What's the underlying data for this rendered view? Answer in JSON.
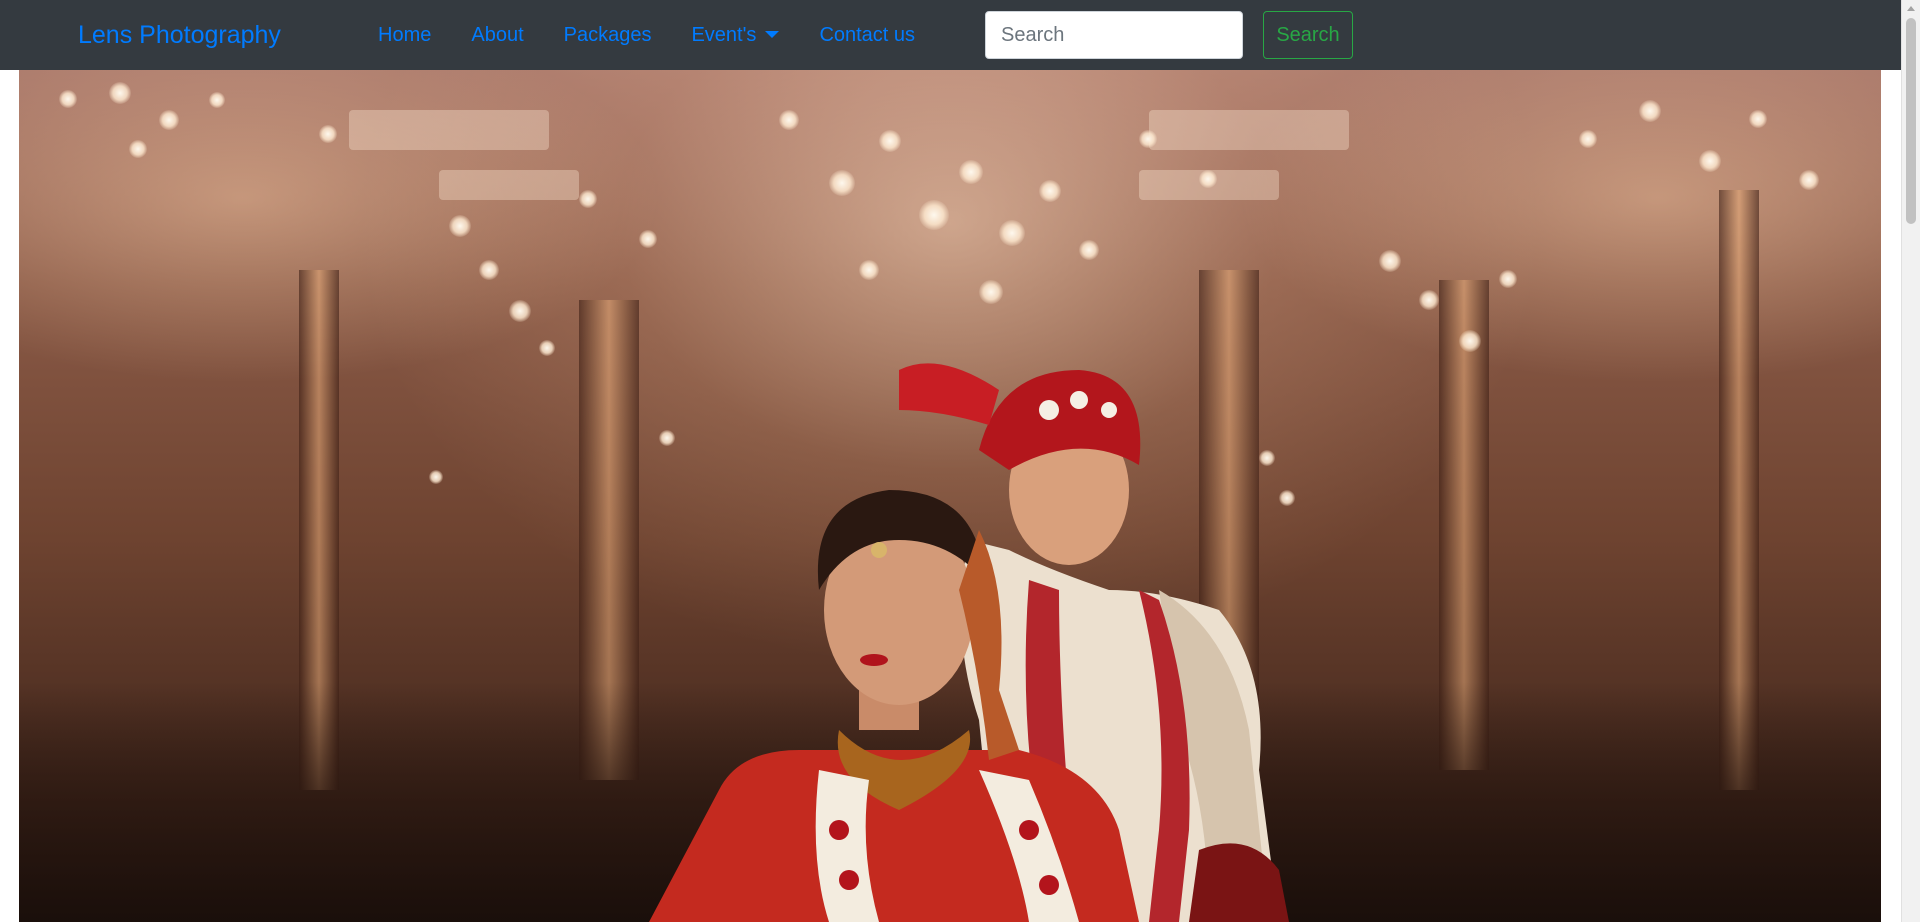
{
  "navbar": {
    "brand": "Lens Photography",
    "links": [
      {
        "label": "Home"
      },
      {
        "label": "About"
      },
      {
        "label": "Packages"
      },
      {
        "label": "Event's"
      },
      {
        "label": "Contact us"
      }
    ],
    "search": {
      "placeholder": "Search",
      "button_label": "Search"
    }
  },
  "colors": {
    "navbar_bg": "#343a40",
    "link": "#007bff",
    "search_button": "#28a745"
  },
  "icons": {
    "events_dropdown": "caret-down-icon"
  }
}
